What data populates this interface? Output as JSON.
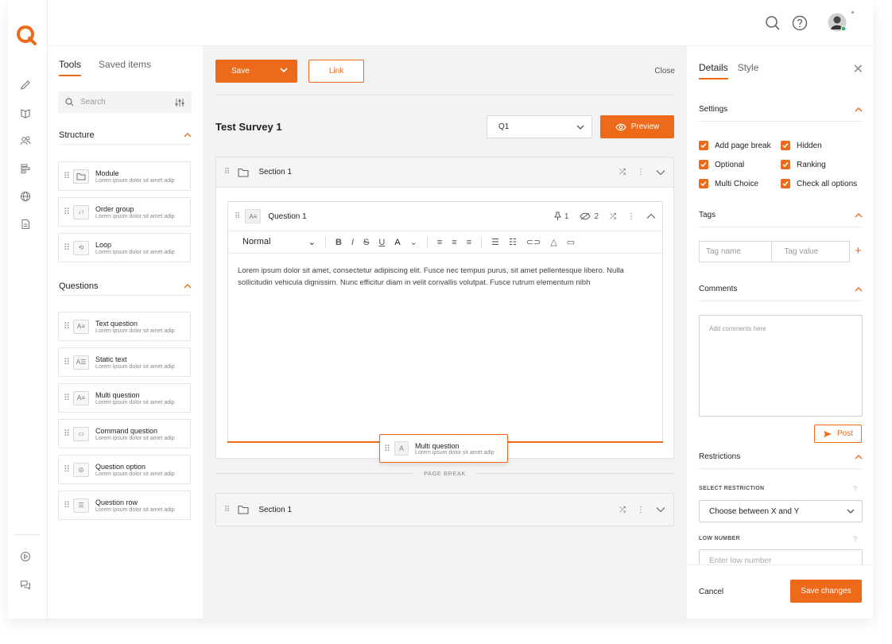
{
  "colors": {
    "accent": "#ec6a1a",
    "panel_bg": "#f3f3f3"
  },
  "rail": {
    "icons": [
      "logo",
      "edit-icon",
      "book-icon",
      "users-icon",
      "layout-icon",
      "globe-icon",
      "document-icon",
      "play-icon",
      "chat-icon"
    ]
  },
  "header": {
    "icons": [
      "search-icon",
      "help-icon",
      "avatar"
    ]
  },
  "tools": {
    "tabs": [
      "Tools",
      "Saved items"
    ],
    "search_placeholder": "Search",
    "structure_title": "Structure",
    "questions_title": "Questions",
    "structure_items": [
      {
        "title": "Module",
        "desc": "Lorem ipsum dolor sit amet adip",
        "icon": "folder-icon"
      },
      {
        "title": "Order group",
        "desc": "Lorem ipsum dolor sit amet adip",
        "icon": "sort-icon"
      },
      {
        "title": "Loop",
        "desc": "Lorem ipsum dolor sit amet adip",
        "icon": "loop-icon"
      }
    ],
    "question_items": [
      {
        "title": "Text question",
        "desc": "Lorem ipsum dolor sit amet adip",
        "icon": "text-icon"
      },
      {
        "title": "Static text",
        "desc": "Lorem ipsum dolor sit amet adip",
        "icon": "static-text-icon"
      },
      {
        "title": "Multi question",
        "desc": "Lorem ipsum dolor sit amet adip",
        "icon": "multi-question-icon"
      },
      {
        "title": "Command question",
        "desc": "Lorem ipsum dolor sit amet adip",
        "icon": "command-icon"
      },
      {
        "title": "Question option",
        "desc": "Lorem ipsum dolor sit amet adip",
        "icon": "option-icon"
      },
      {
        "title": "Question row",
        "desc": "Lorem ipsum dolor sit amet adip",
        "icon": "row-icon"
      }
    ]
  },
  "center": {
    "save_label": "Save",
    "link_label": "Link",
    "close_label": "Close",
    "survey_title": "Test Survey 1",
    "question_select": "Q1",
    "preview_label": "Preview",
    "section1_title": "Section 1",
    "section2_title": "Section 1",
    "question_title": "Question 1",
    "question_icon_text": "A≡",
    "stat_count_1": "1",
    "stat_count_2": "2",
    "text_style": "Normal",
    "body_text": "Lorem ipsum dolor sit amet, consectetur adipiscing elit. Fusce nec tempus purus, sit amet pellentesque libero. Nulla sollicitudin vehicula dignissim. Nunc efficitur diam in velit convallis volutpat. Fusce rutrum elementum nibh",
    "drag_title": "Multi question",
    "drag_desc": "Lorem ipsum dolor sit amet adip",
    "drag_icon_text": "A",
    "page_break": "PAGE BREAK"
  },
  "right": {
    "tabs": [
      "Details",
      "Style"
    ],
    "settings_title": "Settings",
    "checkboxes": [
      {
        "label": "Add page break",
        "checked": true
      },
      {
        "label": "Hidden",
        "checked": true
      },
      {
        "label": "Optional",
        "checked": true
      },
      {
        "label": "Ranking",
        "checked": true
      },
      {
        "label": "Multi Choice",
        "checked": true
      },
      {
        "label": "Check all options",
        "checked": true
      }
    ],
    "tags_title": "Tags",
    "tag_name_placeholder": "Tag name",
    "tag_value_placeholder": "Tag value",
    "comments_title": "Comments",
    "comments_placeholder": "Add comments here",
    "post_label": "Post",
    "restrictions_title": "Restrictions",
    "select_restriction_label": "SELECT RESTRICTION",
    "select_restriction_value": "Choose between X and Y",
    "low_number_label": "LOW NUMBER",
    "low_number_placeholder": "Enter low number",
    "cancel_label": "Cancel",
    "save_changes_label": "Save changes"
  }
}
